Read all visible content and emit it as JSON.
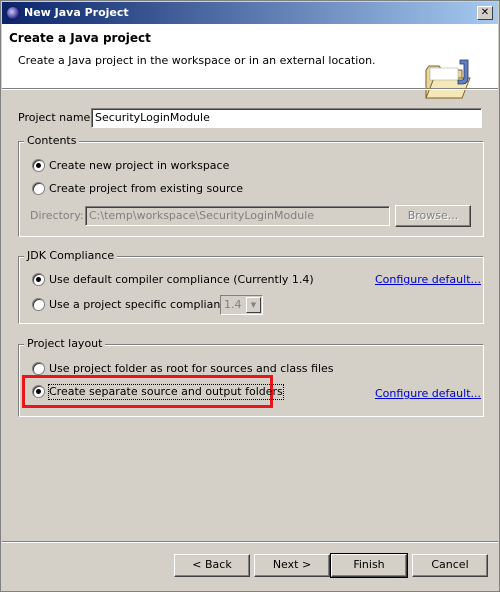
{
  "window": {
    "title": "New Java Project",
    "close_glyph": "✕"
  },
  "banner": {
    "title": "Create a Java project",
    "subtitle": "Create a Java project in the workspace or in an external location.",
    "icon": "java-folder-icon"
  },
  "project_name": {
    "label": "Project name:",
    "value": "SecurityLoginModule"
  },
  "contents": {
    "title": "Contents",
    "option_new": "Create new project in workspace",
    "option_existing": "Create project from existing source",
    "directory_label": "Directory:",
    "directory_value": "C:\\temp\\workspace\\SecurityLoginModule",
    "browse_label": "Browse..."
  },
  "jdk": {
    "title": "JDK Compliance",
    "option_default": "Use default compiler compliance (Currently 1.4)",
    "option_specific": "Use a project specific compliance:",
    "compliance_value": "1.4",
    "configure_link": "Configure default..."
  },
  "layout": {
    "title": "Project layout",
    "option_root": "Use project folder as root for sources and class files",
    "option_separate": "Create separate source and output folders",
    "configure_link": "Configure default..."
  },
  "buttons": {
    "back": "< Back",
    "next": "Next >",
    "finish": "Finish",
    "cancel": "Cancel"
  },
  "colors": {
    "highlight": "#e8161a",
    "titlebar_start": "#0a246a",
    "titlebar_end": "#a6caf0",
    "link": "#0000cc"
  }
}
